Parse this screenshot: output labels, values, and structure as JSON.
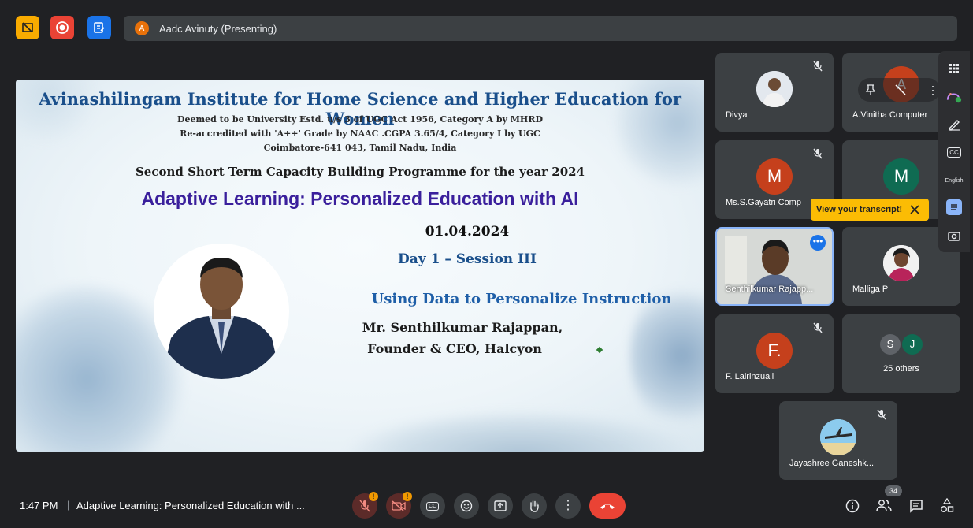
{
  "presenting": {
    "avatar_letter": "A",
    "label": "Aadc Avinuty (Presenting)"
  },
  "slide": {
    "title": "Avinashilingam Institute for Home Science and Higher Education for Women",
    "line1": "Deemed to be University Estd. u/s 3 of UGC Act 1956, Category A by MHRD",
    "line2": "Re-accredited with 'A++' Grade by NAAC  .CGPA 3.65/4, Category I by UGC",
    "line3": "Coimbatore-641 043, Tamil Nadu, India",
    "programme": "Second Short Term Capacity Building Programme for the year 2024",
    "topic": "Adaptive Learning: Personalized Education with AI",
    "date": "01.04.2024",
    "session": "Day 1 – Session III",
    "talk": "Using Data to Personalize Instruction",
    "speaker": "Mr. Senthilkumar Rajappan,",
    "role": "Founder & CEO, Halcyon"
  },
  "participants": [
    {
      "name": "Divya",
      "avatar": ""
    },
    {
      "name": "A.Vinitha Computer",
      "avatar": "A"
    },
    {
      "name": "Ms.S.Gayatri Comp",
      "avatar": "M"
    },
    {
      "name": "",
      "avatar": "M"
    },
    {
      "name": "Senthilkumar Rajapp...",
      "avatar": ""
    },
    {
      "name": "Malliga P",
      "avatar": ""
    },
    {
      "name": "F. Lalrinzuali",
      "avatar": "F."
    },
    {
      "name": "25 others",
      "avatar": "",
      "others_letters": [
        "S",
        "J"
      ]
    },
    {
      "name": "Jayashree Ganeshk...",
      "avatar": ""
    }
  ],
  "tooltip": {
    "text": "View your transcript!"
  },
  "side_panel": {
    "language": "English",
    "cc": "CC"
  },
  "bottom": {
    "time": "1:47 PM",
    "separator": "|",
    "meeting_title": "Adaptive Learning: Personalized Education with ...",
    "badge_mic": "!",
    "badge_cam": "!",
    "cc_label": "CC",
    "people_count": "34"
  },
  "colors": {
    "background": "#202124",
    "tile": "#3c4043",
    "avatar_red": "#c5401c",
    "avatar_green": "#0f6b52",
    "end_call": "#ea4335",
    "tooltip": "#fbbc04",
    "accent_blue": "#8ab4f8",
    "slide_title_blue": "#1a4f8b",
    "slide_topic_purple": "#3a1f9c"
  }
}
